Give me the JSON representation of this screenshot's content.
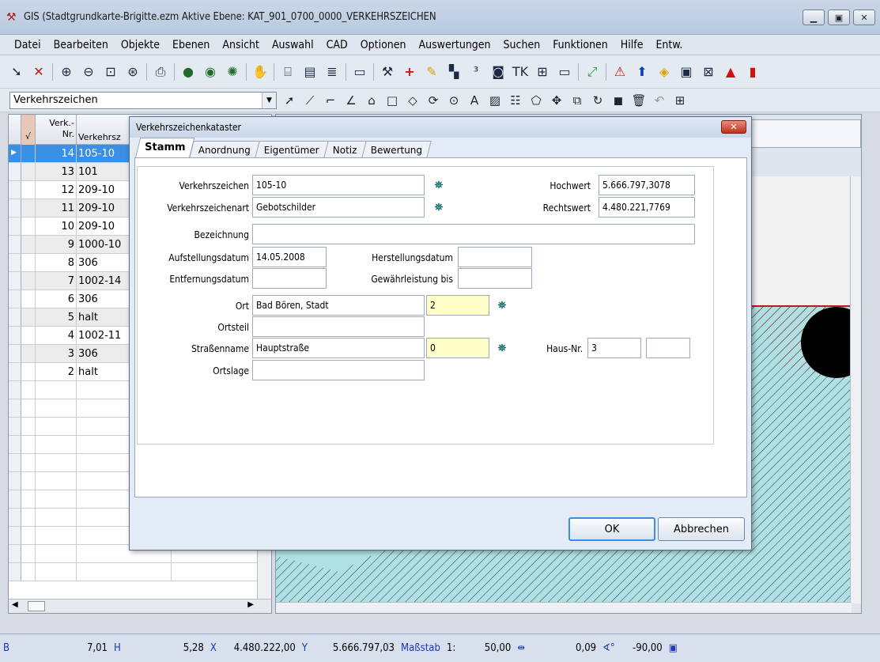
{
  "window": {
    "title": "GIS (Stadtgrundkarte-Brigitte.ezm Aktive Ebene: KAT_901_0700_0000_VERKEHRSZEICHEN",
    "buttons": [
      "minimize",
      "maximize",
      "close"
    ]
  },
  "menu": [
    "Datei",
    "Bearbeiten",
    "Objekte",
    "Ebenen",
    "Ansicht",
    "Auswahl",
    "CAD",
    "Optionen",
    "Auswertungen",
    "Suchen",
    "Funktionen",
    "Hilfe",
    "Entw."
  ],
  "toolbar": {
    "layer_combo": "Verkehrszeichen"
  },
  "grid": {
    "col_check": "√",
    "col_nr": "Verk.-\nNr.",
    "col_zeichen": "Verkehrsz",
    "rows": [
      {
        "nr": "14",
        "zeichen": "105-10",
        "selected": true
      },
      {
        "nr": "13",
        "zeichen": "101"
      },
      {
        "nr": "12",
        "zeichen": "209-10"
      },
      {
        "nr": "11",
        "zeichen": "209-10"
      },
      {
        "nr": "10",
        "zeichen": "209-10"
      },
      {
        "nr": "9",
        "zeichen": "1000-10"
      },
      {
        "nr": "8",
        "zeichen": "306"
      },
      {
        "nr": "7",
        "zeichen": "1002-14"
      },
      {
        "nr": "6",
        "zeichen": "306"
      },
      {
        "nr": "5",
        "zeichen": "halt"
      },
      {
        "nr": "4",
        "zeichen": "1002-11"
      },
      {
        "nr": "3",
        "zeichen": "306"
      },
      {
        "nr": "2",
        "zeichen": "halt"
      }
    ]
  },
  "dialog": {
    "title": "Verkehrszeichenkataster",
    "tabs": [
      "Stamm",
      "Anordnung",
      "Eigentümer",
      "Notiz",
      "Bewertung"
    ],
    "fields": {
      "verkehrszeichen_label": "Verkehrszeichen",
      "verkehrszeichen": "105-10",
      "art_label": "Verkehrszeichenart",
      "art": "Gebotschilder",
      "hochwert_label": "Hochwert",
      "hochwert": "5.666.797,3078",
      "rechtswert_label": "Rechtswert",
      "rechtswert": "4.480.221,7769",
      "bezeichnung_label": "Bezeichnung",
      "bezeichnung": "",
      "aufstellungsdatum_label": "Aufstellungsdatum",
      "aufstellungsdatum": "14.05.2008",
      "herstellungsdatum_label": "Herstellungsdatum",
      "herstellungsdatum": "",
      "entfernungsdatum_label": "Entfernungsdatum",
      "entfernungsdatum": "",
      "gewaehrleistung_label": "Gewährleistung bis",
      "gewaehrleistung": "",
      "ort_label": "Ort",
      "ort": "Bad Bören, Stadt",
      "ort_code": "2",
      "ortsteil_label": "Ortsteil",
      "ortsteil": "",
      "strasse_label": "Straßenname",
      "strasse": "Hauptstraße",
      "strasse_code": "0",
      "hausnr_label": "Haus-Nr.",
      "hausnr": "3",
      "hausnr_zusatz": "",
      "ortslage_label": "Ortslage",
      "ortslage": ""
    },
    "ok": "OK",
    "cancel": "Abbrechen"
  },
  "status": {
    "b": "B",
    "v1": "7,01",
    "h": "H",
    "v2": "5,28",
    "x": "X",
    "xval": "4.480.222,00",
    "y": "Y",
    "yval": "5.666.797,03",
    "massstab": "Maßstab",
    "scale_prefix": "1:",
    "scale": "50,00",
    "angle1": "0,09",
    "angle_sym": "∢°",
    "angle2": "-90,00"
  }
}
